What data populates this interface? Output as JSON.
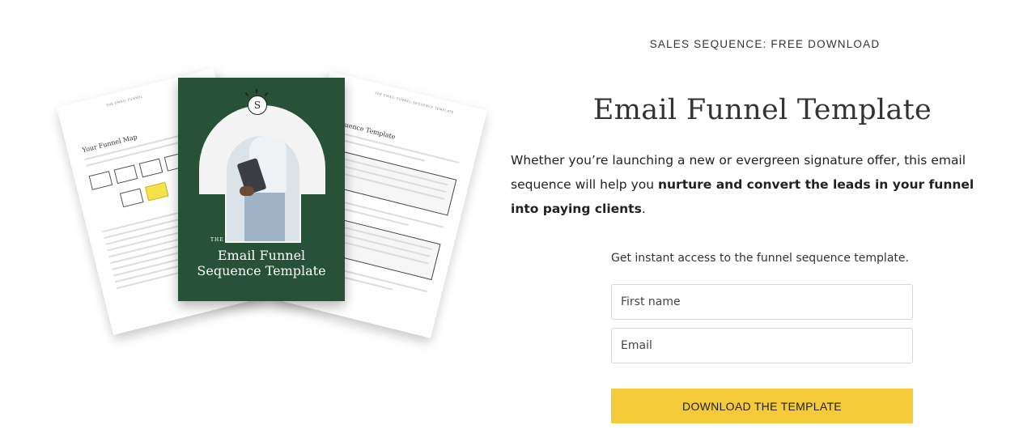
{
  "mockup": {
    "cover_small": "THE",
    "cover_title_line1": "Email Funnel",
    "cover_title_line2": "Sequence Template",
    "logo_letter": "S",
    "left_page_title": "Your Funnel Map",
    "right_page_title": "Sequence Template",
    "cover_color": "#275237"
  },
  "header": {
    "eyebrow": "SALES SEQUENCE: FREE DOWNLOAD",
    "title": "Email Funnel Template"
  },
  "description": {
    "part1": "Whether you’re launching a new or evergreen signature offer, this email sequence will help you ",
    "bold": "nurture and convert the leads in your funnel into paying clients",
    "part2": "."
  },
  "form": {
    "intro": "Get instant access to the funnel sequence template.",
    "first_name_placeholder": "First name",
    "email_placeholder": "Email",
    "submit_label": "DOWNLOAD THE TEMPLATE",
    "button_color": "#f5ca39"
  }
}
